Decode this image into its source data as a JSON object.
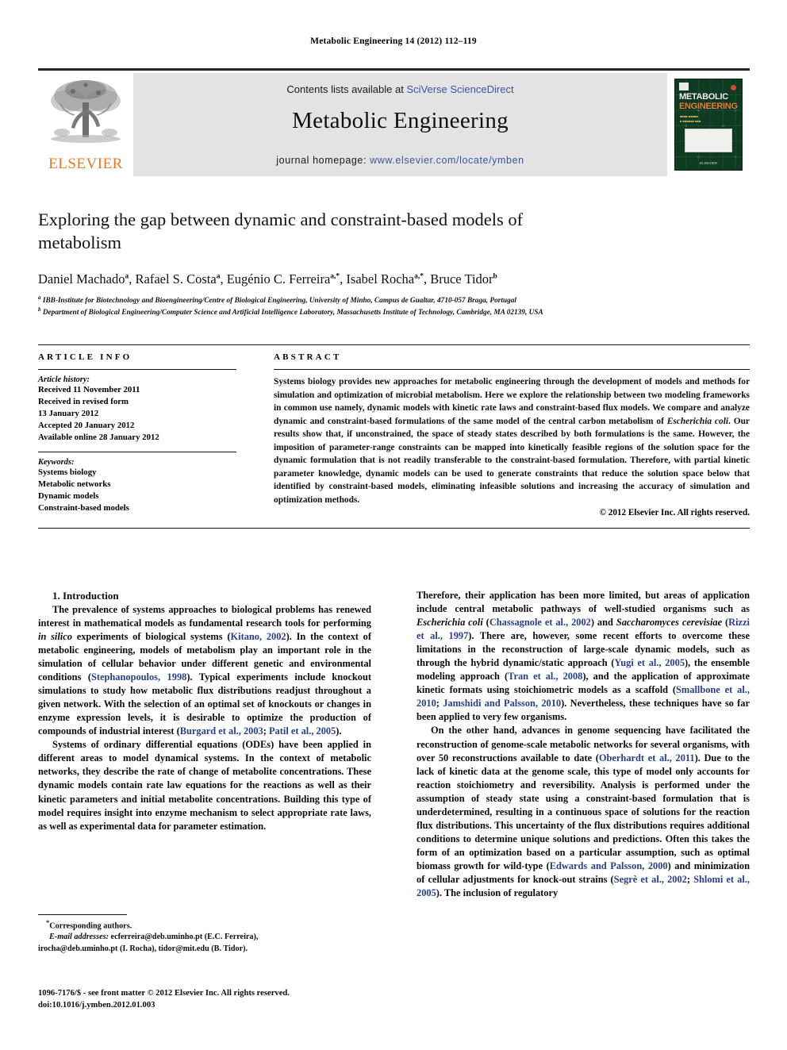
{
  "running_head": "Metabolic Engineering 14 (2012) 112–119",
  "masthead": {
    "publisher": "ELSEVIER",
    "contents_prefix": "Contents lists available at ",
    "contents_link": "SciVerse ScienceDirect",
    "journal_name": "Metabolic Engineering",
    "homepage_prefix": "journal homepage: ",
    "homepage_url": "www.elsevier.com/locate/ymben",
    "cover": {
      "title_line1": "METABOLIC",
      "title_line2": "ENGINEERING",
      "footer": "ELSEVIER"
    }
  },
  "article": {
    "title": "Exploring the gap between dynamic and constraint-based models of metabolism",
    "authors": [
      {
        "name": "Daniel Machado",
        "marks": "a"
      },
      {
        "name": "Rafael S. Costa",
        "marks": "a"
      },
      {
        "name": "Eugénio C. Ferreira",
        "marks": "a,*"
      },
      {
        "name": "Isabel Rocha",
        "marks": "a,*"
      },
      {
        "name": "Bruce Tidor",
        "marks": "b"
      }
    ],
    "affiliations": [
      {
        "mark": "a",
        "text": "IBB-Institute for Biotechnology and Bioengineering/Centre of Biological Engineering, University of Minho, Campus de Gualtar, 4710-057 Braga, Portugal"
      },
      {
        "mark": "b",
        "text": "Department of Biological Engineering/Computer Science and Artificial Intelligence Laboratory, Massachusetts Institute of Technology, Cambridge, MA 02139, USA"
      }
    ]
  },
  "article_info": {
    "heading": "ARTICLE INFO",
    "history_label": "Article history:",
    "history": [
      "Received 11 November 2011",
      "Received in revised form",
      "13 January 2012",
      "Accepted 20 January 2012",
      "Available online 28 January 2012"
    ],
    "keywords_label": "Keywords:",
    "keywords": [
      "Systems biology",
      "Metabolic networks",
      "Dynamic models",
      "Constraint-based models"
    ]
  },
  "abstract": {
    "heading": "ABSTRACT",
    "part1": "Systems biology provides new approaches for metabolic engineering through the development of models and methods for simulation and optimization of microbial metabolism. Here we explore the relationship between two modeling frameworks in common use namely, dynamic models with kinetic rate laws and constraint-based flux models. We compare and analyze dynamic and constraint-based formulations of the same model of the central carbon metabolism of ",
    "organism": "Escherichia coli",
    "part2": ". Our results show that, if unconstrained, the space of steady states described by both formulations is the same. However, the imposition of parameter-range constraints can be mapped into kinetically feasible regions of the solution space for the dynamic formulation that is not readily transferable to the constraint-based formulation. Therefore, with partial kinetic parameter knowledge, dynamic models can be used to generate constraints that reduce the solution space below that identified by constraint-based models, eliminating infeasible solutions and increasing the accuracy of simulation and optimization methods.",
    "copyright": "© 2012 Elsevier Inc. All rights reserved."
  },
  "body": {
    "section_number_title": "1.  Introduction",
    "left": {
      "p1_a": "The prevalence of systems approaches to biological problems has renewed interest in mathematical models as fundamental research tools for performing ",
      "p1_ital": "in silico",
      "p1_b": " experiments of biological systems (",
      "p1_cite1": "Kitano, 2002",
      "p1_c": "). In the context of metabolic engineering, models of metabolism play an important role in the simulation of cellular behavior under different genetic and environmental conditions (",
      "p1_cite2": "Stephanopoulos, 1998",
      "p1_d": "). Typical experiments include knockout simulations to study how metabolic flux distributions readjust throughout a given network. With the selection of an optimal set of knockouts or changes in enzyme expression levels, it is desirable to optimize the production of compounds of industrial interest (",
      "p1_cite3": "Burgard et al., 2003",
      "p1_e": "; ",
      "p1_cite4": "Patil et al., 2005",
      "p1_f": ").",
      "p2": "Systems of ordinary differential equations (ODEs) have been applied in different areas to model dynamical systems. In the context of metabolic networks, they describe the rate of change of metabolite concentrations. These dynamic models contain rate law equations for the reactions as well as their kinetic parameters and initial metabolite concentrations. Building this type of model requires insight into enzyme mechanism to select appropriate rate laws, as well as experimental data for parameter estimation."
    },
    "right": {
      "p1_a": "Therefore, their application has been more limited, but areas of application include central metabolic pathways of well-studied organisms such as ",
      "p1_ital1": "Escherichia coli",
      "p1_b": " (",
      "p1_cite1": "Chassagnole et al., 2002",
      "p1_c": ") and ",
      "p1_ital2": "Saccharomyces cerevisiae",
      "p1_d": " (",
      "p1_cite2": "Rizzi et al., 1997",
      "p1_e": "). There are, however, some recent efforts to overcome these limitations in the reconstruction of large-scale dynamic models, such as through the hybrid dynamic/static approach (",
      "p1_cite3": "Yugi et al., 2005",
      "p1_f": "), the ensemble modeling approach (",
      "p1_cite4": "Tran et al., 2008",
      "p1_g": "), and the application of approximate kinetic formats using stoichiometric models as a scaffold (",
      "p1_cite5": "Smallbone et al., 2010",
      "p1_h": "; ",
      "p1_cite6": "Jamshidi and Palsson, 2010",
      "p1_i": "). Nevertheless, these techniques have so far been applied to very few organisms.",
      "p2_a": "On the other hand, advances in genome sequencing have facilitated the reconstruction of genome-scale metabolic networks for several organisms, with over 50 reconstructions available to date (",
      "p2_cite1": "Oberhardt et al., 2011",
      "p2_b": "). Due to the lack of kinetic data at the genome scale, this type of model only accounts for reaction stoichiometry and reversibility. Analysis is performed under the assumption of steady state using a constraint-based formulation that is underdetermined, resulting in a continuous space of solutions for the reaction flux distributions. This uncertainty of the flux distributions requires additional conditions to determine unique solutions and predictions. Often this takes the form of an optimization based on a particular assumption, such as optimal biomass growth for wild-type (",
      "p2_cite2": "Edwards and Palsson, 2000",
      "p2_c": ") and minimization of cellular adjustments for knock-out strains (",
      "p2_cite3": "Segrè et al., 2002",
      "p2_d": "; ",
      "p2_cite4": "Shlomi et al., 2005",
      "p2_e": "). The inclusion of regulatory"
    }
  },
  "footnotes": {
    "corresponding": "Corresponding authors.",
    "email_label": "E-mail addresses:",
    "email_line1": " ecferreira@deb.uminho.pt (E.C. Ferreira),",
    "email_line2": "irocha@deb.uminho.pt (I. Rocha), tidor@mit.edu (B. Tidor)."
  },
  "issn": {
    "line1": "1096-7176/$ - see front matter © 2012 Elsevier Inc. All rights reserved.",
    "line2": "doi:10.1016/j.ymben.2012.01.003"
  },
  "colors": {
    "link_blue": "#3a55a5",
    "citation_blue": "#27408b",
    "elsevier_orange": "#E87722",
    "cover_green": "#0e3b22"
  }
}
